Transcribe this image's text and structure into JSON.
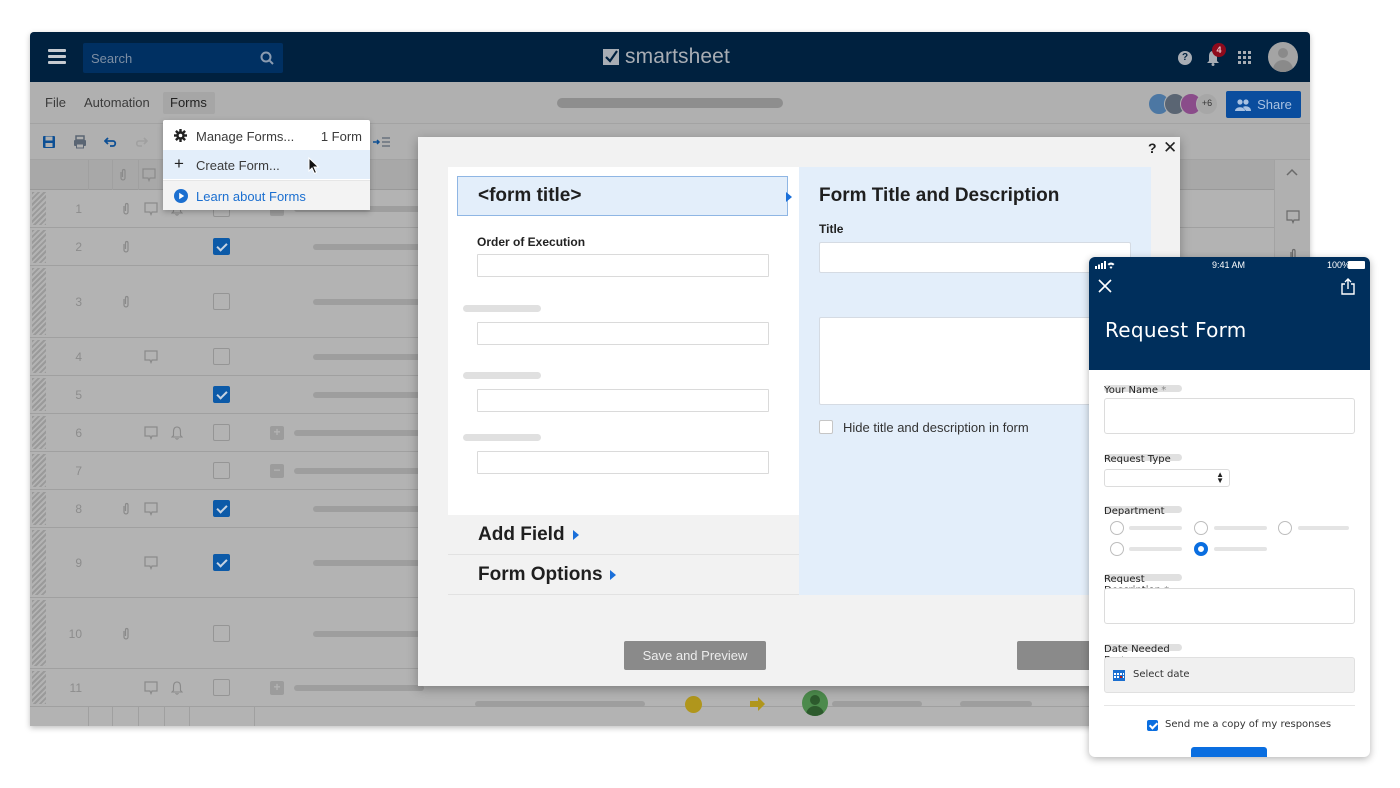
{
  "app": {
    "brand": "smartsheet",
    "search_placeholder": "Search",
    "notification_count": "4",
    "help_label": "?",
    "accent_color": "#0a4d9e"
  },
  "menubar": {
    "items": [
      "File",
      "Automation",
      "Forms"
    ],
    "collaborators_extra": "+6",
    "share_label": "Share"
  },
  "forms_menu": {
    "items": [
      {
        "icon": "gear-icon",
        "label": "Manage Forms...",
        "count": "1 Form"
      },
      {
        "icon": "plus-icon",
        "label": "Create Form..."
      },
      {
        "icon": "play-circle-icon",
        "label": "Learn about Forms"
      }
    ]
  },
  "grid": {
    "rows": [
      {
        "num": "1",
        "attachment": true,
        "comment": true,
        "reminder": true,
        "checked": false,
        "expander": "collapse"
      },
      {
        "num": "2",
        "attachment": true,
        "comment": false,
        "reminder": false,
        "checked": true,
        "expander": null
      },
      {
        "num": "3",
        "attachment": true,
        "comment": false,
        "reminder": false,
        "checked": false,
        "expander": null
      },
      {
        "num": "4",
        "attachment": false,
        "comment": true,
        "reminder": false,
        "checked": false,
        "expander": null
      },
      {
        "num": "5",
        "attachment": false,
        "comment": false,
        "reminder": false,
        "checked": true,
        "expander": null
      },
      {
        "num": "6",
        "attachment": false,
        "comment": true,
        "reminder": true,
        "checked": false,
        "expander": "expand"
      },
      {
        "num": "7",
        "attachment": false,
        "comment": false,
        "reminder": false,
        "checked": false,
        "expander": "collapse"
      },
      {
        "num": "8",
        "attachment": true,
        "comment": true,
        "reminder": false,
        "checked": true,
        "expander": null
      },
      {
        "num": "9",
        "attachment": false,
        "comment": true,
        "reminder": false,
        "checked": true,
        "expander": null
      },
      {
        "num": "10",
        "attachment": true,
        "comment": false,
        "reminder": false,
        "checked": false,
        "expander": null
      },
      {
        "num": "11",
        "attachment": false,
        "comment": true,
        "reminder": true,
        "checked": false,
        "expander": "expand"
      }
    ]
  },
  "form_builder": {
    "help": "?",
    "close": "✕",
    "form_title_placeholder": "<form title>",
    "field_label": "Order of Execution",
    "add_field": "Add Field",
    "form_options": "Form Options",
    "panel_title": "Form Title and Description",
    "title_label": "Title",
    "title_value": "",
    "description_value": "",
    "hide_checkbox_label": "Hide title and description in form",
    "hide_checked": false,
    "save_preview_label": "Save and Preview"
  },
  "mobile_form": {
    "status_time": "9:41 AM",
    "status_battery": "100%",
    "title": "Request Form",
    "fields": {
      "name_label": "Your Name",
      "request_type_label": "Request Type",
      "department_label": "Department",
      "department_selected_index": 4,
      "description_label": "Request Description",
      "date_label": "Date Needed By",
      "date_placeholder": "Select date",
      "required_mark": "*"
    },
    "copy_label": "Send me a copy of my responses",
    "copy_checked": true,
    "primary_color": "#0a6ee0",
    "header_color": "#002f5c"
  }
}
